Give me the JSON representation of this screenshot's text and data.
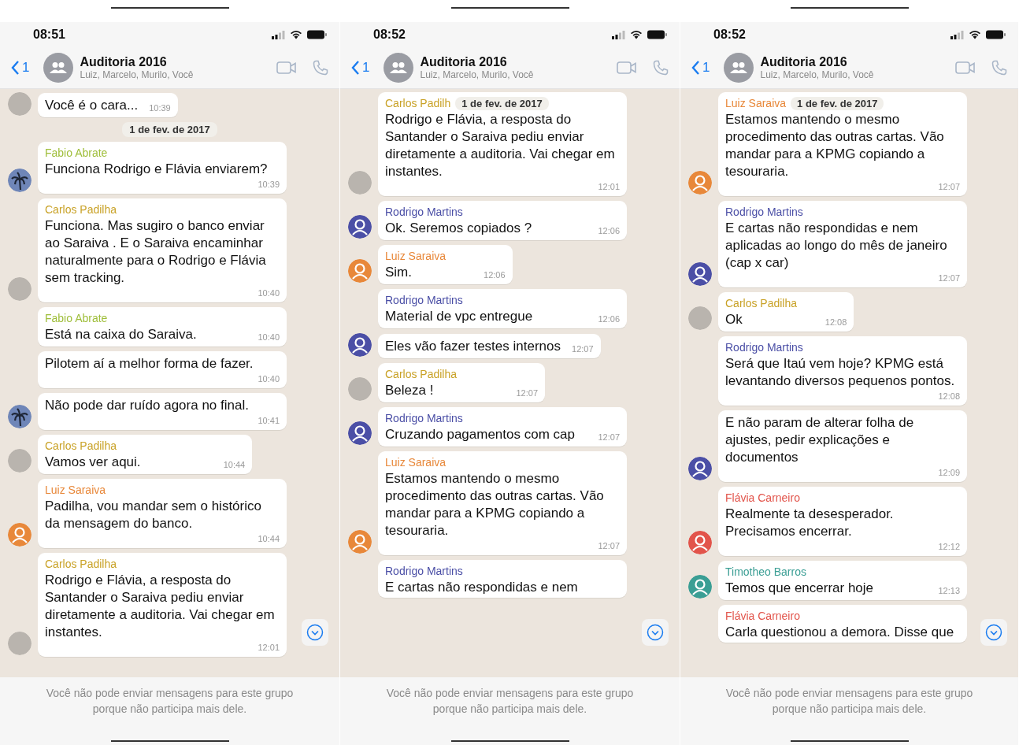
{
  "panels": [
    {
      "status_time": "08:51",
      "back_count": "1",
      "title": "Auditoria 2016",
      "subtitle": "Luiz, Marcelo, Murilo, Você",
      "footer": "Você não pode enviar mensagens para este grupo porque não participa mais dele.",
      "messages": [
        {
          "kind": "message",
          "text": "Você é o cara...",
          "time": "10:39",
          "avatar": {
            "kind": "photo"
          }
        },
        {
          "kind": "date",
          "text": "1 de fev. de 2017"
        },
        {
          "kind": "message",
          "sender": "Fabio Abrate",
          "color": "#9fbe3a",
          "text": "Funciona Rodrigo e Flávia enviarem?",
          "time": "10:39",
          "avatar": {
            "kind": "palm"
          }
        },
        {
          "kind": "message",
          "sender": "Carlos Padilha",
          "color": "#c9a227",
          "text": "Funciona. Mas sugiro o banco enviar ao Saraiva . E o Saraiva encaminhar naturalmente para o Rodrigo e Flávia sem tracking.",
          "time": "10:40",
          "avatar": {
            "kind": "photo"
          }
        },
        {
          "kind": "message",
          "sender": "Fabio Abrate",
          "color": "#9fbe3a",
          "text": "Está na caixa do Saraiva.",
          "time": "10:40"
        },
        {
          "kind": "message",
          "text": "Pilotem aí a melhor forma de fazer.",
          "time": "10:40"
        },
        {
          "kind": "message",
          "text": "Não pode dar ruído agora no final.",
          "time": "10:41",
          "avatar": {
            "kind": "palm"
          }
        },
        {
          "kind": "message",
          "sender": "Carlos Padilha",
          "color": "#c9a227",
          "text": "Vamos ver aqui.",
          "time": "10:44",
          "avatar": {
            "kind": "photo"
          }
        },
        {
          "kind": "message",
          "sender": "Luiz Saraiva",
          "color": "#e8883a",
          "text": "Padilha, vou mandar sem o histórico da mensagem do banco.",
          "time": "10:44",
          "avatar": {
            "kind": "person",
            "color": "#e8883a"
          }
        },
        {
          "kind": "message",
          "sender": "Carlos Padilha",
          "color": "#c9a227",
          "text": "Rodrigo e Flávia, a resposta do Santander o Saraiva pediu enviar diretamente a auditoria. Vai chegar em instantes.",
          "time": "12:01",
          "avatar": {
            "kind": "photo"
          }
        }
      ]
    },
    {
      "status_time": "08:52",
      "back_count": "1",
      "title": "Auditoria 2016",
      "subtitle": "Luiz, Marcelo, Murilo, Você",
      "footer": "Você não pode enviar mensagens para este grupo porque não participa mais dele.",
      "messages": [
        {
          "kind": "message",
          "sender": "Carlos Padilh",
          "color": "#c9a227",
          "date_chip": "1 de fev. de 2017",
          "text": "Rodrigo e Flávia, a resposta do Santander o Saraiva pediu enviar diretamente a auditoria. Vai chegar em instantes.",
          "time": "12:01",
          "avatar": {
            "kind": "photo"
          }
        },
        {
          "kind": "message",
          "sender": "Rodrigo Martins",
          "color": "#4b4fa6",
          "text": "Ok. Seremos copiados ?",
          "time": "12:06",
          "avatar": {
            "kind": "person",
            "color": "#4b4fa6"
          }
        },
        {
          "kind": "message",
          "sender": "Luiz Saraiva",
          "color": "#e8883a",
          "text": "Sim.",
          "time": "12:06",
          "avatar": {
            "kind": "person",
            "color": "#e8883a"
          }
        },
        {
          "kind": "message",
          "sender": "Rodrigo Martins",
          "color": "#4b4fa6",
          "text": "Material de vpc entregue",
          "time": "12:06"
        },
        {
          "kind": "message",
          "text": "Eles vão fazer testes internos",
          "time": "12:07",
          "avatar": {
            "kind": "person",
            "color": "#4b4fa6"
          }
        },
        {
          "kind": "message",
          "sender": "Carlos Padilha",
          "color": "#c9a227",
          "text": "Beleza !",
          "time": "12:07",
          "avatar": {
            "kind": "photo"
          }
        },
        {
          "kind": "message",
          "sender": "Rodrigo Martins",
          "color": "#4b4fa6",
          "text": "Cruzando pagamentos com cap",
          "time": "12:07",
          "avatar": {
            "kind": "person",
            "color": "#4b4fa6"
          }
        },
        {
          "kind": "message",
          "sender": "Luiz Saraiva",
          "color": "#e8883a",
          "text": "Estamos mantendo o mesmo procedimento das outras cartas. Vão mandar para a KPMG copiando a tesouraria.",
          "time": "12:07",
          "avatar": {
            "kind": "person",
            "color": "#e8883a"
          }
        },
        {
          "kind": "partial",
          "sender": "Rodrigo Martins",
          "color": "#4b4fa6",
          "text": "E cartas não respondidas e nem"
        }
      ]
    },
    {
      "status_time": "08:52",
      "back_count": "1",
      "title": "Auditoria 2016",
      "subtitle": "Luiz, Marcelo, Murilo, Você",
      "footer": "Você não pode enviar mensagens para este grupo porque não participa mais dele.",
      "messages": [
        {
          "kind": "message",
          "sender": "Luiz Saraiva",
          "color": "#e8883a",
          "date_chip": "1 de fev. de 2017",
          "text": "Estamos mantendo o mesmo procedimento das outras cartas. Vão mandar para a KPMG copiando a tesouraria.",
          "time": "12:07",
          "avatar": {
            "kind": "person",
            "color": "#e8883a"
          }
        },
        {
          "kind": "message",
          "sender": "Rodrigo Martins",
          "color": "#4b4fa6",
          "text": "E cartas não respondidas e nem aplicadas ao longo do mês de janeiro (cap x car)",
          "time": "12:07",
          "avatar": {
            "kind": "person",
            "color": "#4b4fa6"
          }
        },
        {
          "kind": "message",
          "sender": "Carlos Padilha",
          "color": "#c9a227",
          "text": "Ok",
          "time": "12:08",
          "avatar": {
            "kind": "photo"
          }
        },
        {
          "kind": "message",
          "sender": "Rodrigo Martins",
          "color": "#4b4fa6",
          "text": "Será que Itaú vem hoje? KPMG está levantando diversos pequenos pontos.",
          "time": "12:08"
        },
        {
          "kind": "message",
          "text": "E não param de alterar folha de ajustes, pedir explicações e documentos",
          "time": "12:09",
          "avatar": {
            "kind": "person",
            "color": "#4b4fa6"
          }
        },
        {
          "kind": "message",
          "sender": "Flávia Carneiro",
          "color": "#e2544b",
          "text": "Realmente ta desesperador. Precisamos encerrar.",
          "time": "12:12",
          "avatar": {
            "kind": "person",
            "color": "#e2544b"
          }
        },
        {
          "kind": "message",
          "sender": "Timotheo Barros",
          "color": "#3a9e94",
          "text": "Temos que encerrar hoje",
          "time": "12:13",
          "avatar": {
            "kind": "person",
            "color": "#3a9e94"
          }
        },
        {
          "kind": "partial",
          "sender": "Flávia Carneiro",
          "color": "#e2544b",
          "text": "Carla questionou a demora. Disse que"
        }
      ]
    }
  ]
}
